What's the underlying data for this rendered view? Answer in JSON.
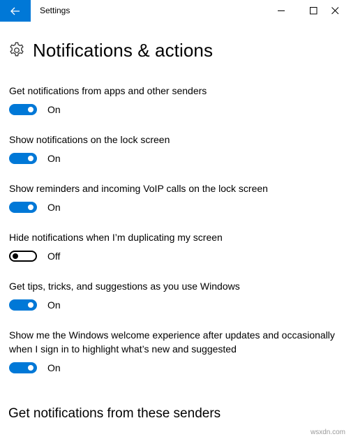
{
  "window": {
    "title": "Settings"
  },
  "page": {
    "title": "Notifications & actions"
  },
  "settings": [
    {
      "label": "Get notifications from apps and other senders",
      "state": "On"
    },
    {
      "label": "Show notifications on the lock screen",
      "state": "On"
    },
    {
      "label": "Show reminders and incoming VoIP calls on the lock screen",
      "state": "On"
    },
    {
      "label": "Hide notifications when I’m duplicating my screen",
      "state": "Off"
    },
    {
      "label": "Get tips, tricks, and suggestions as you use Windows",
      "state": "On"
    },
    {
      "label": "Show me the Windows welcome experience after updates and occasionally when I sign in to highlight what’s new and suggested",
      "state": "On"
    }
  ],
  "section": {
    "title": "Get notifications from these senders"
  },
  "watermark": "wsxdn.com",
  "colors": {
    "accent": "#0078d7",
    "toggle_off_border": "#000000"
  },
  "icons": [
    "back-arrow-icon",
    "minimize-icon",
    "maximize-icon",
    "close-icon",
    "gear-icon"
  ]
}
